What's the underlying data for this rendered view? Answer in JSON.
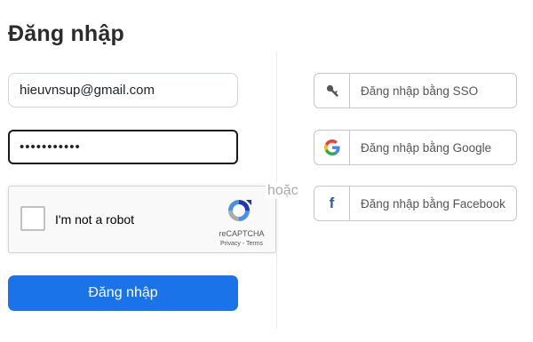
{
  "login": {
    "title": "Đăng nhập",
    "email_value": "hieuvnsup@gmail.com",
    "password_value": "•••••••••••",
    "submit_label": "Đăng nhập"
  },
  "captcha": {
    "checkbox_label": "I'm not a robot",
    "brand": "reCAPTCHA",
    "terms": "Privacy - Terms"
  },
  "divider": {
    "text": "hoặc"
  },
  "sso": {
    "items": [
      {
        "icon": "key-icon",
        "label": "Đăng nhập bằng SSO"
      },
      {
        "icon": "google-icon",
        "label": "Đăng nhập bằng Google"
      },
      {
        "icon": "facebook-icon",
        "label": "Đăng nhập bằng Facebook"
      }
    ]
  },
  "colors": {
    "primary": "#1a73e8",
    "facebook": "#3b5998"
  }
}
